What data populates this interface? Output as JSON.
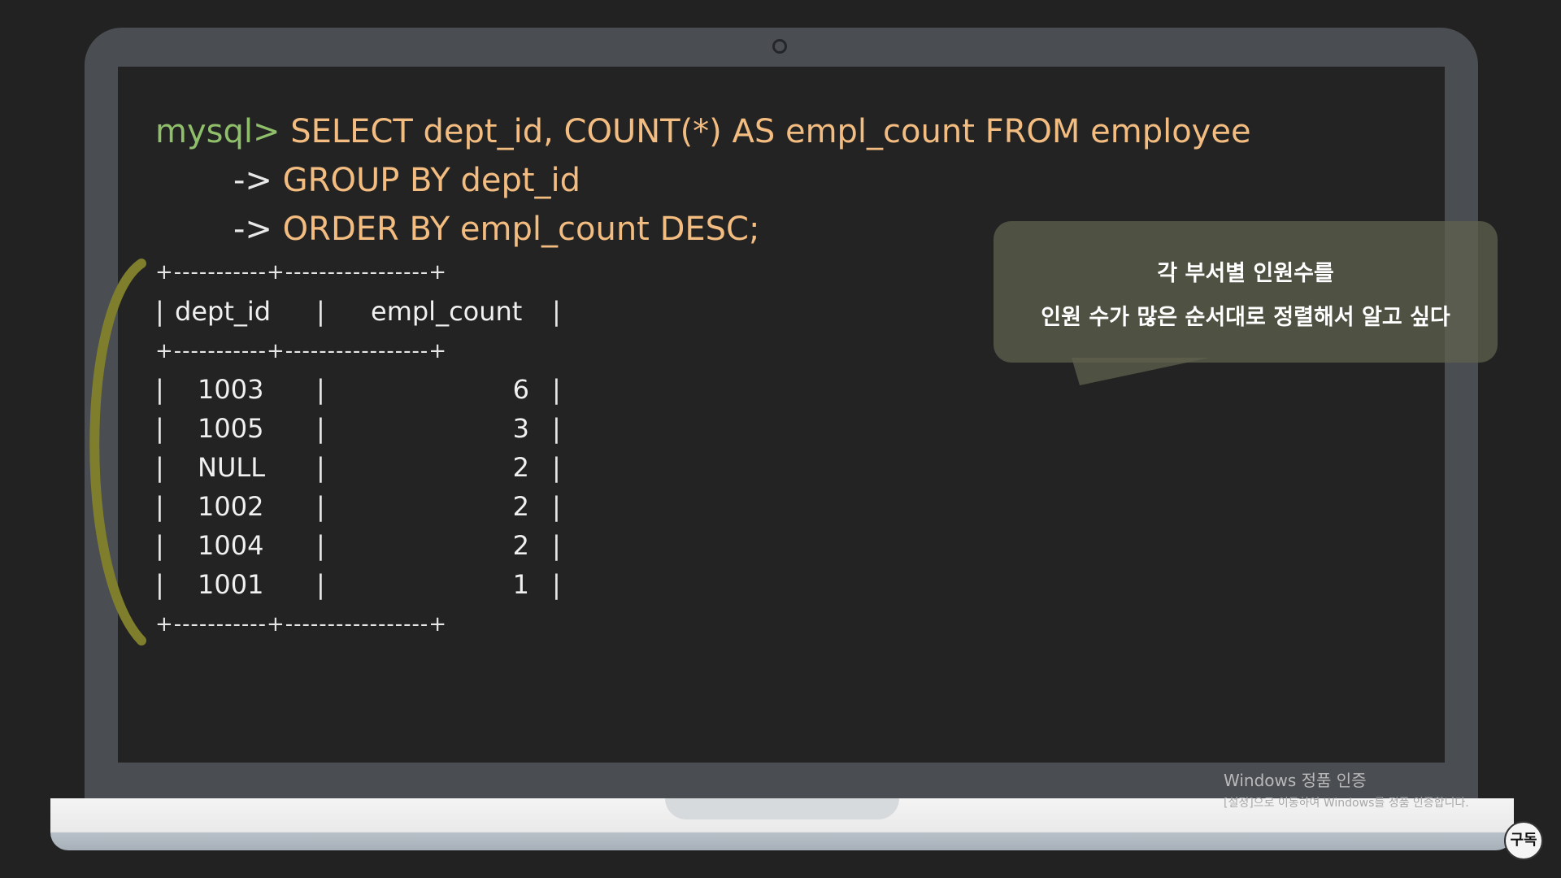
{
  "terminal": {
    "prompt": "mysql>",
    "line1": "SELECT dept_id, COUNT(*) AS empl_count FROM employee",
    "line2_arrow": "->",
    "line2": "GROUP BY dept_id",
    "line3_arrow": "->",
    "line3": "ORDER BY empl_count DESC;"
  },
  "result_table": {
    "border": "+-----------+-----------------+",
    "headers": [
      "dept_id",
      "empl_count"
    ],
    "rows": [
      {
        "dept_id": "1003",
        "empl_count": "6"
      },
      {
        "dept_id": "1005",
        "empl_count": "3"
      },
      {
        "dept_id": "NULL",
        "empl_count": "2"
      },
      {
        "dept_id": "1002",
        "empl_count": "2"
      },
      {
        "dept_id": "1004",
        "empl_count": "2"
      },
      {
        "dept_id": "1001",
        "empl_count": "1"
      }
    ]
  },
  "speech_bubble": {
    "line1": "각 부서별 인원수를",
    "line2": "인원 수가 많은 순서대로 정렬해서 알고 싶다"
  },
  "watermark": {
    "title": "Windows 정품 인증",
    "subtitle": "[설정]으로 이동하여 Windows를 정품 인증합니다."
  },
  "subscribe_label": "구독",
  "colors": {
    "prompt": "#8fbf6a",
    "sql": "#f3bc80",
    "bracket": "#7f7e2c"
  }
}
